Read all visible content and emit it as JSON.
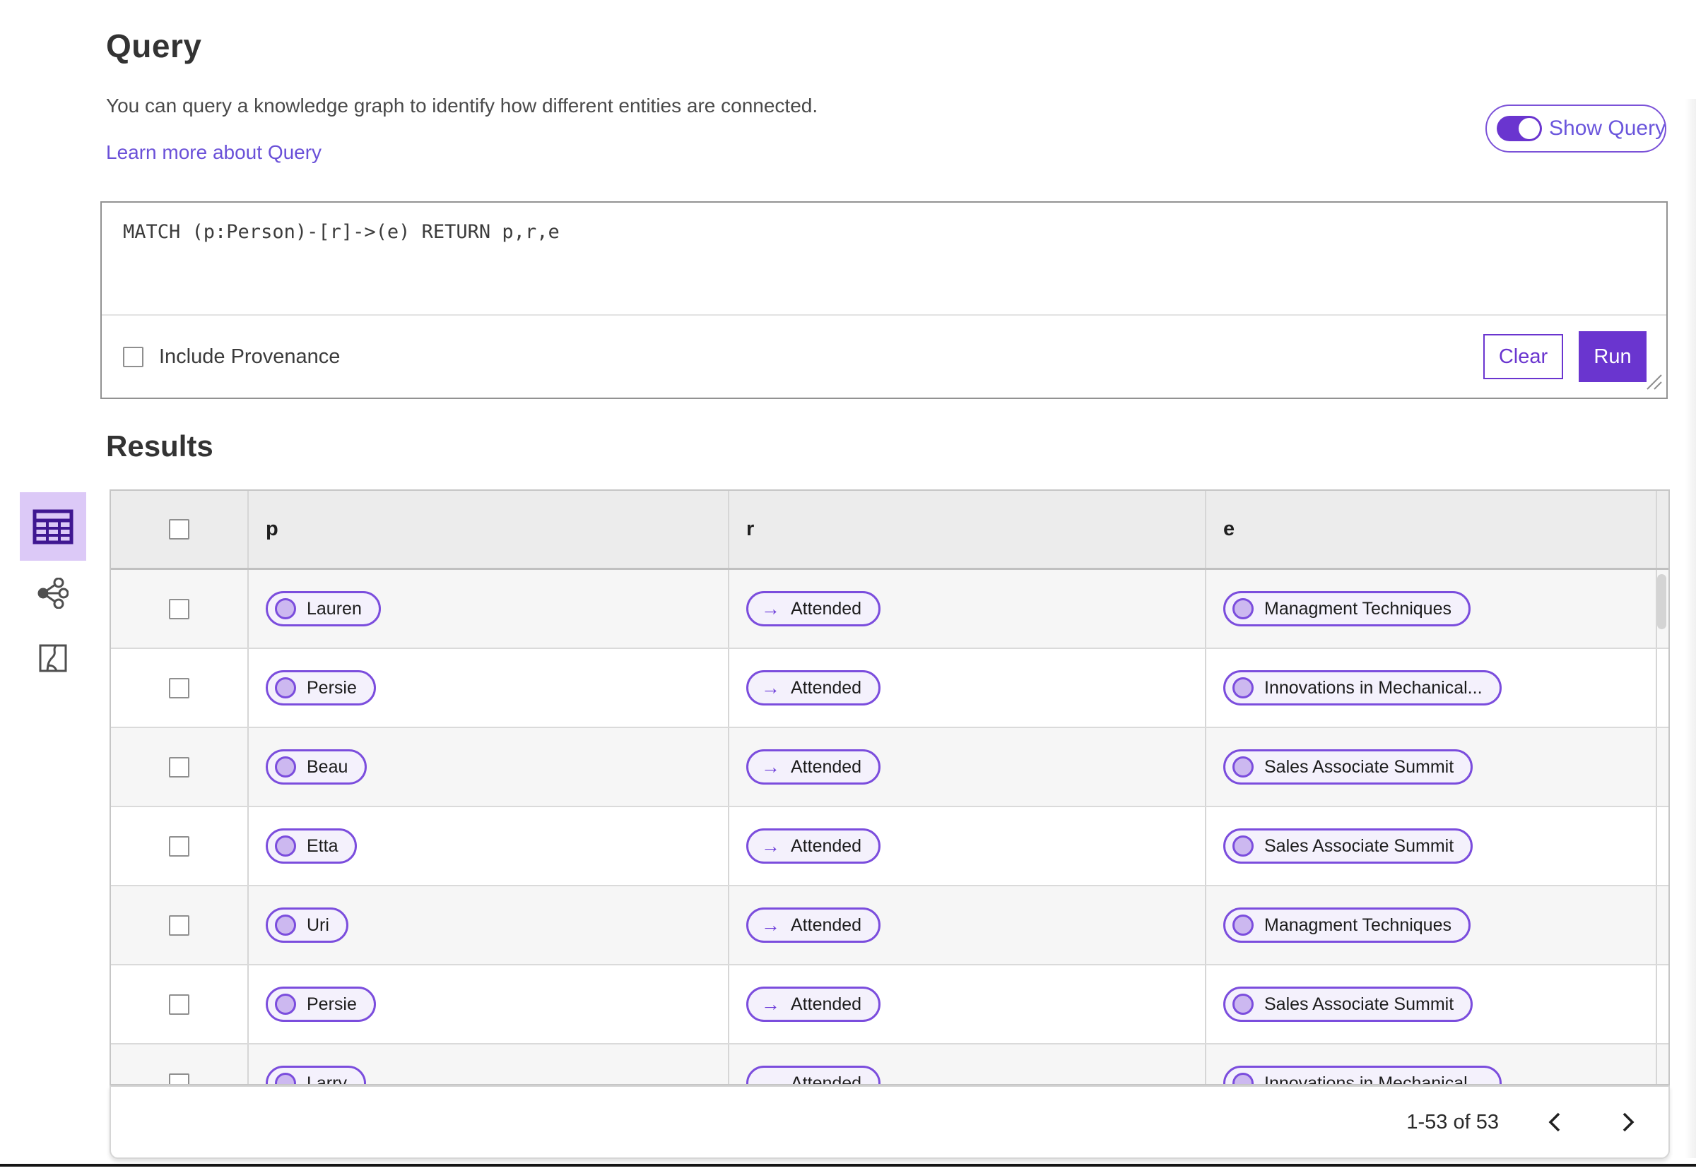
{
  "header": {
    "title": "Query",
    "description": "You can query a knowledge graph to identify how different entities are connected.",
    "learn_more": "Learn more about Query",
    "show_query_label": "Show Query",
    "show_query_on": true
  },
  "query_panel": {
    "query_text": "MATCH (p:Person)-[r]->(e) RETURN p,r,e",
    "include_provenance_label": "Include Provenance",
    "include_provenance_checked": false,
    "clear_label": "Clear",
    "run_label": "Run"
  },
  "results": {
    "title": "Results",
    "views": [
      "table-view",
      "graph-view",
      "map-view"
    ],
    "selected_view": "table-view"
  },
  "table": {
    "columns": [
      "p",
      "r",
      "e"
    ],
    "relation_arrow": "→",
    "rows": [
      {
        "p": "Lauren",
        "r": "Attended",
        "e": "Managment Techniques"
      },
      {
        "p": "Persie",
        "r": "Attended",
        "e": "Innovations in Mechanical..."
      },
      {
        "p": "Beau",
        "r": "Attended",
        "e": "Sales Associate Summit"
      },
      {
        "p": "Etta",
        "r": "Attended",
        "e": "Sales Associate Summit"
      },
      {
        "p": "Uri",
        "r": "Attended",
        "e": "Managment Techniques"
      },
      {
        "p": "Persie",
        "r": "Attended",
        "e": "Sales Associate Summit"
      },
      {
        "p": "Larry",
        "r": "Attended",
        "e": "Innovations in Mechanical..."
      }
    ]
  },
  "pagination": {
    "range_label": "1-53 of 53"
  },
  "colors": {
    "accent_purple": "#6a35cf",
    "pill_border": "#7b4ddd",
    "pill_bg": "#f4f1fc",
    "entity_circle_fill": "#ccb8f0",
    "selected_view_bg": "#dcc9f7",
    "selected_view_icon": "#3f1791",
    "link_purple": "#6a50d8",
    "header_row_bg": "#ececec",
    "alt_row_bg": "#f6f6f6"
  }
}
